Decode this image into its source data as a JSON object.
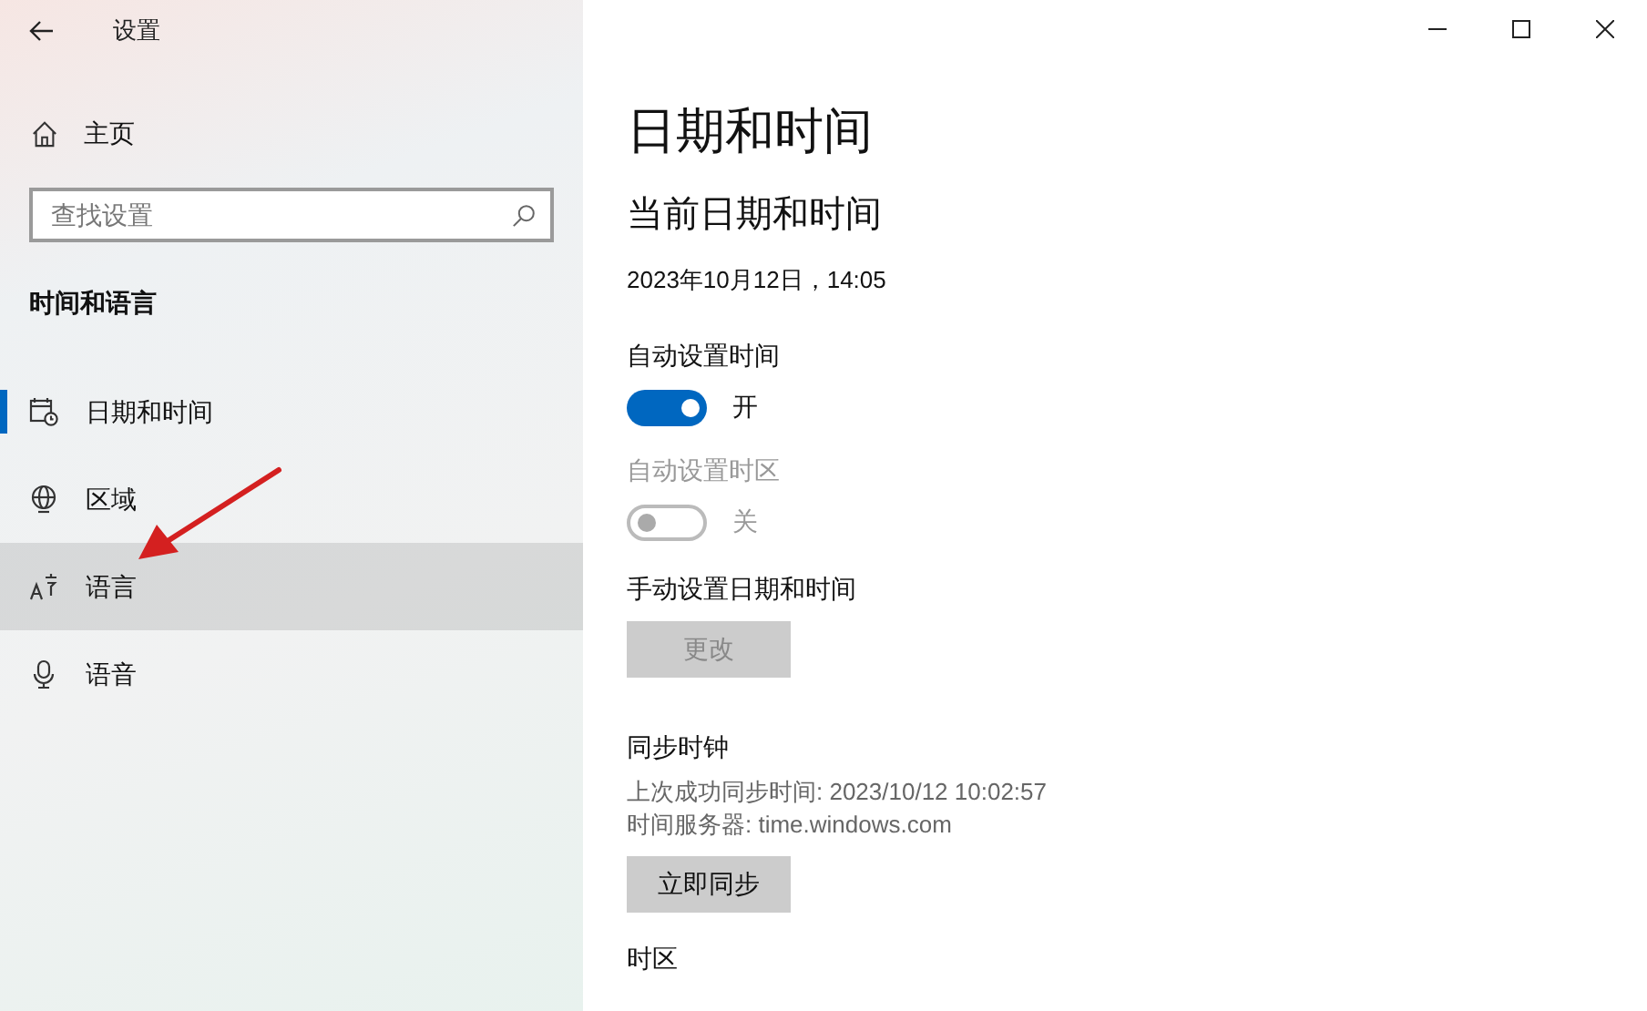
{
  "window": {
    "title": "设置"
  },
  "sidebar": {
    "home": "主页",
    "search": {
      "placeholder": "查找设置"
    },
    "section": "时间和语言",
    "items": [
      {
        "label": "日期和时间",
        "kind": "calendar",
        "selected": true,
        "highlighted": false
      },
      {
        "label": "区域",
        "kind": "globe",
        "selected": false,
        "highlighted": false
      },
      {
        "label": "语言",
        "kind": "language",
        "selected": false,
        "highlighted": true
      },
      {
        "label": "语音",
        "kind": "microphone",
        "selected": false,
        "highlighted": false
      }
    ]
  },
  "page": {
    "title": "日期和时间",
    "subtitle": "当前日期和时间",
    "current": "2023年10月12日，14:05",
    "settings": [
      {
        "label": "自动设置时间",
        "on": true,
        "disabled": false,
        "state_label": "开"
      },
      {
        "label": "自动设置时区",
        "on": false,
        "disabled": true,
        "state_label": "关"
      }
    ],
    "manual": {
      "label": "手动设置日期和时间",
      "button": "更改",
      "disabled": true
    },
    "sync": {
      "label": "同步时钟",
      "last": "上次成功同步时间: 2023/10/12 10:02:57",
      "server": "时间服务器: time.windows.com",
      "button": "立即同步",
      "disabled": false
    },
    "next_heading": "时区"
  }
}
